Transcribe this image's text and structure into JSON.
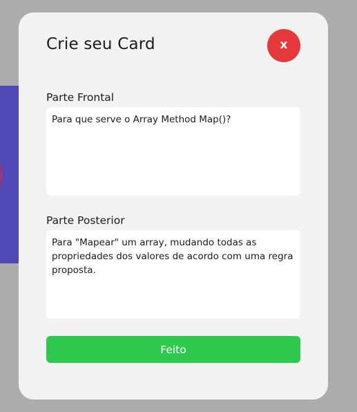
{
  "modal": {
    "title": "Crie seu Card",
    "close_label": "x",
    "front": {
      "label": "Parte Frontal",
      "value": "Para que serve o Array Method Map()?"
    },
    "back": {
      "label": "Parte Posterior",
      "value": "Para \"Mapear\" um array, mudando todas as propriedades dos valores de acordo com uma regra proposta."
    },
    "done_label": "Feito"
  },
  "colors": {
    "overlay": "#acacac",
    "modal_bg": "#f2f2f2",
    "close_button": "#e63a3a",
    "done_button": "#2ec94f",
    "backdrop_card": "#5148b8"
  }
}
